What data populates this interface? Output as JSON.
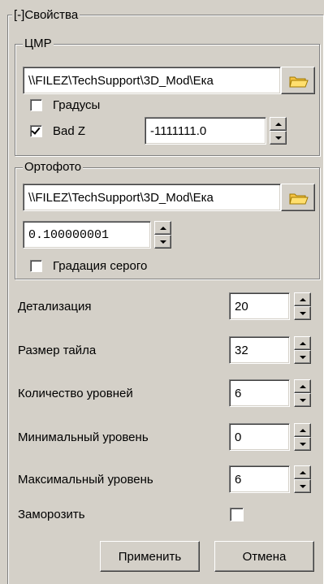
{
  "properties": {
    "title": "[-]Свойства"
  },
  "dem": {
    "title": "ЦМР",
    "path_value": "\\\\FILEZ\\TechSupport\\3D_Mod\\Ека",
    "degrees_label": "Градусы",
    "degrees_checked": false,
    "badz_label": "Bad Z",
    "badz_checked": true,
    "badz_value": "-1111111.0"
  },
  "ortho": {
    "title": "Ортофото",
    "path_value": "\\\\FILEZ\\TechSupport\\3D_Mod\\Ека",
    "resolution_value": "0.100000001",
    "grayscale_label": "Градация серого",
    "grayscale_checked": false
  },
  "settings": {
    "rows": [
      {
        "label": "Детализация",
        "value": "20"
      },
      {
        "label": "Размер тайла",
        "value": "32"
      },
      {
        "label": "Количество уровней",
        "value": "6"
      },
      {
        "label": "Минимальный уровень",
        "value": "0"
      },
      {
        "label": "Максимальный уровень",
        "value": "6"
      }
    ],
    "freeze_label": "Заморозить",
    "freeze_checked": false
  },
  "buttons": {
    "apply": "Применить",
    "cancel": "Отмена"
  },
  "icons": {
    "browse": "folder-open-icon",
    "spin_up": "spin-up-arrow-icon",
    "spin_down": "spin-down-arrow-icon"
  },
  "colors": {
    "background": "#d4d0c8",
    "folder": "#f6c342"
  }
}
